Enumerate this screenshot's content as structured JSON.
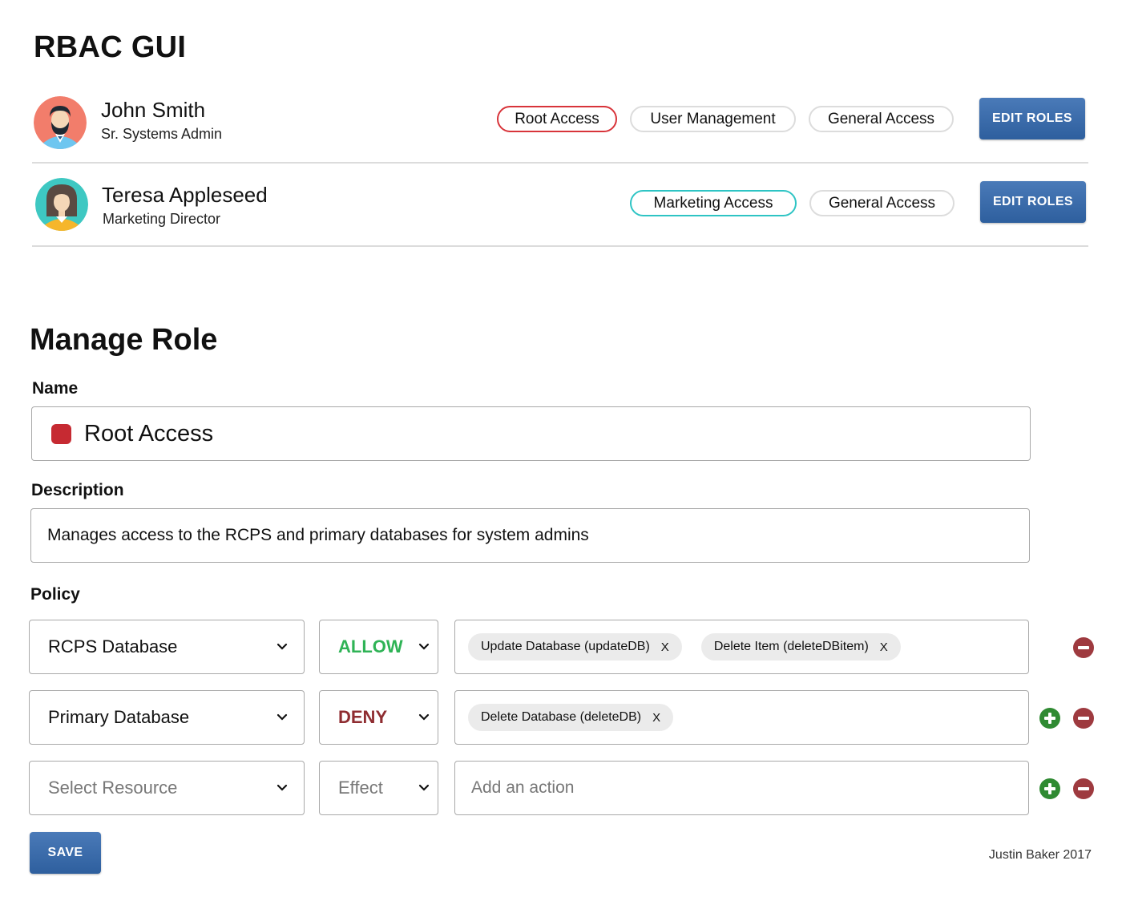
{
  "app": {
    "title": "RBAC GUI"
  },
  "users": [
    {
      "name": "John Smith",
      "title": "Sr. Systems Admin",
      "roles": [
        "Root Access",
        "User Management",
        "General Access"
      ],
      "edit_label": "EDIT ROLES",
      "avatar_icon": "male-avatar-icon"
    },
    {
      "name": "Teresa Appleseed",
      "title": "Marketing Director",
      "roles": [
        "Marketing Access",
        "General Access"
      ],
      "edit_label": "EDIT ROLES",
      "avatar_icon": "female-avatar-icon"
    }
  ],
  "manage_role": {
    "title": "Manage Role",
    "name_label": "Name",
    "name_value": "Root Access",
    "role_color": "#c62a32",
    "description_label": "Description",
    "description_value": "Manages access to the RCPS and primary databases for system admins",
    "policy_label": "Policy",
    "policies": [
      {
        "resource": "RCPS Database",
        "effect": "ALLOW",
        "actions": [
          "Update Database (updateDB)",
          "Delete Item (deleteDBitem)"
        ]
      },
      {
        "resource": "Primary Database",
        "effect": "DENY",
        "actions": [
          "Delete Database (deleteDB)"
        ]
      },
      {
        "resource_placeholder": "Select Resource",
        "effect_placeholder": "Effect",
        "action_placeholder": "Add an action"
      }
    ],
    "chip_remove_label": "X",
    "save_label": "SAVE"
  },
  "colors": {
    "root_access_border": "#d8343a",
    "marketing_access_border": "#2ec4c4",
    "allow": "#2fb356",
    "deny": "#8f2d31",
    "add_button": "#2f8a32",
    "remove_button": "#9e3a3f",
    "primary_button": "#3a6aa9"
  },
  "footer": {
    "credit": "Justin Baker 2017"
  }
}
